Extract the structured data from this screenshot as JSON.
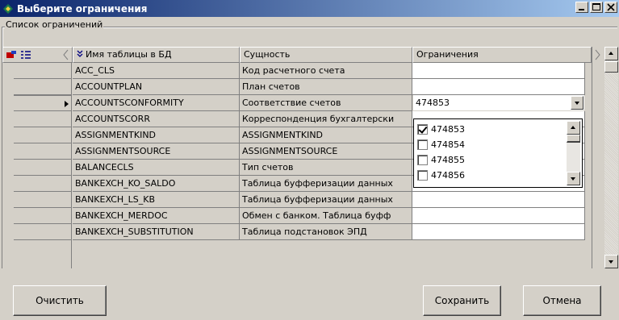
{
  "window": {
    "title": "Выберите ограничения"
  },
  "group": {
    "label": "Список ограничений"
  },
  "grid": {
    "columns": [
      "Имя таблицы в БД",
      "Сущность",
      "Ограничения"
    ],
    "rows": [
      {
        "table": "ACC_CLS",
        "entity": "Код расчетного счета",
        "restriction": ""
      },
      {
        "table": "ACCOUNTPLAN",
        "entity": "План счетов",
        "restriction": ""
      },
      {
        "table": "ACCOUNTSCONFORMITY",
        "entity": "Соответствие счетов",
        "restriction": "474853"
      },
      {
        "table": "ACCOUNTSCORR",
        "entity": "Корреспонденция бухгалтерски",
        "restriction": ""
      },
      {
        "table": "ASSIGNMENTKIND",
        "entity": "ASSIGNMENTKIND",
        "restriction": ""
      },
      {
        "table": "ASSIGNMENTSOURCE",
        "entity": "ASSIGNMENTSOURCE",
        "restriction": ""
      },
      {
        "table": "BALANCECLS",
        "entity": "Тип счетов",
        "restriction": ""
      },
      {
        "table": "BANKEXCH_KO_SALDO",
        "entity": "Таблица буфферизации данных",
        "restriction": ""
      },
      {
        "table": "BANKEXCH_LS_KB",
        "entity": "Таблица буфферизации данных",
        "restriction": ""
      },
      {
        "table": "BANKEXCH_MERDOC",
        "entity": "Обмен с банком. Таблица буфф",
        "restriction": ""
      },
      {
        "table": "BANKEXCH_SUBSTITUTION",
        "entity": "Таблица подстановок ЭПД",
        "restriction": ""
      }
    ],
    "current_row_index": 2
  },
  "dropdown": {
    "items": [
      {
        "label": "474853",
        "checked": true
      },
      {
        "label": "474854",
        "checked": false
      },
      {
        "label": "474855",
        "checked": false
      },
      {
        "label": "474856",
        "checked": false
      }
    ]
  },
  "buttons": {
    "clear": "Очистить",
    "save": "Сохранить",
    "cancel": "Отмена"
  },
  "icons": [
    "app-icon",
    "filter-icon",
    "list-icon",
    "sort-icon",
    "window-minimize-icon",
    "window-maximize-icon",
    "window-close-icon"
  ]
}
